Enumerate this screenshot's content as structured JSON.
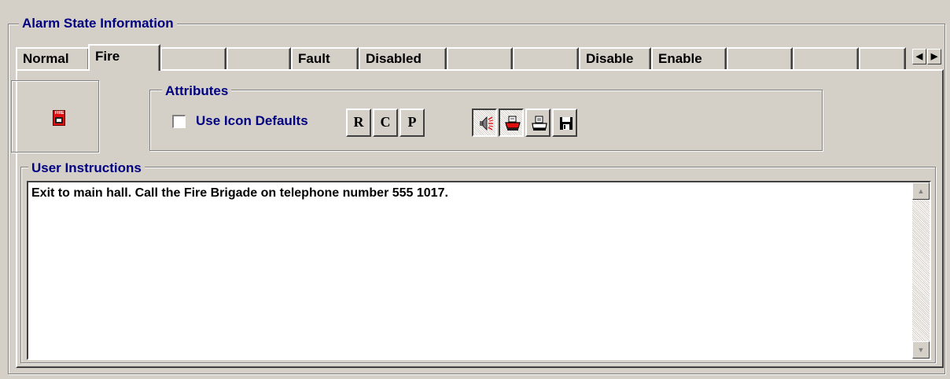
{
  "group": {
    "title": "Alarm State Information"
  },
  "tabs": [
    {
      "label": "Normal"
    },
    {
      "label": "Fire"
    },
    {
      "label": ""
    },
    {
      "label": ""
    },
    {
      "label": "Fault"
    },
    {
      "label": "Disabled"
    },
    {
      "label": ""
    },
    {
      "label": ""
    },
    {
      "label": "Disable"
    },
    {
      "label": "Enable"
    },
    {
      "label": ""
    },
    {
      "label": ""
    },
    {
      "label": ""
    }
  ],
  "active_tab": "Fire",
  "icon": {
    "name": "fire-alarm-icon",
    "label": "FIRE"
  },
  "attributes": {
    "title": "Attributes",
    "use_icon_defaults_label": "Use Icon Defaults",
    "use_icon_defaults_checked": false,
    "buttons": [
      {
        "name": "r-button",
        "label": "R"
      },
      {
        "name": "c-button",
        "label": "C"
      },
      {
        "name": "p-button",
        "label": "P"
      },
      {
        "name": "siren-button",
        "icon": "siren-icon",
        "pressed": true
      },
      {
        "name": "printer-color-button",
        "icon": "printer-icon",
        "pressed": true
      },
      {
        "name": "printer-button",
        "icon": "printer-icon"
      },
      {
        "name": "save-button",
        "icon": "floppy-disk-icon"
      }
    ]
  },
  "user_instructions": {
    "title": "User Instructions",
    "text": "Exit to main hall. Call the Fire Brigade on telephone number 555 1017."
  },
  "colors": {
    "face": "#d4d0c8",
    "legend_text": "#000080",
    "fire_red": "#e01010"
  }
}
